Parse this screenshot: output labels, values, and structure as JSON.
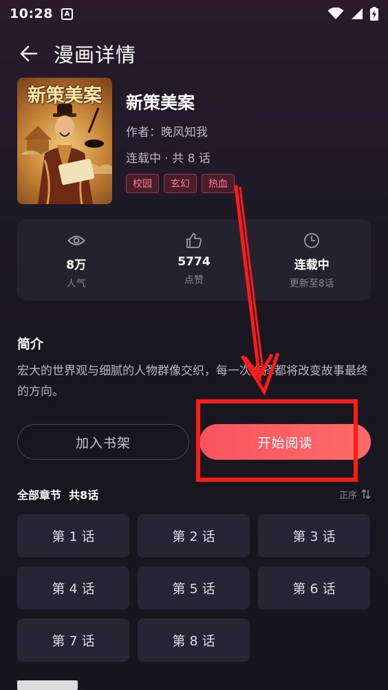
{
  "status_bar": {
    "time": "10:28",
    "a_icon": "A"
  },
  "header": {
    "title": "漫画详情"
  },
  "comic": {
    "cover_title": "新策美案",
    "title": "新策美案",
    "author": "作者：晚风知我",
    "status": "连载中 · 共 8 话",
    "tags": [
      "校园",
      "玄幻",
      "热血"
    ]
  },
  "stats": [
    {
      "icon": "eye-icon",
      "value": "8万",
      "label": "人气"
    },
    {
      "icon": "thumbs-up-icon",
      "value": "5774",
      "label": "点赞"
    },
    {
      "icon": "clock-icon",
      "value": "连载中",
      "label": "更新至8话"
    }
  ],
  "intro": {
    "title": "简介",
    "text": "宏大的世界观与细腻的人物群像交织，每一次选择都将改变故事最终的方向。"
  },
  "actions": {
    "shelf_label": "加入书架",
    "read_label": "开始阅读"
  },
  "chapters": {
    "title": "全部章节  共8话",
    "sort_label": "正序",
    "items": [
      "第 1 话",
      "第 2 话",
      "第 3 话",
      "第 4 话",
      "第 5 话",
      "第 6 话",
      "第 7 话",
      "第 8 话"
    ]
  },
  "colors": {
    "accent": "#f8555f",
    "annotation": "#ff1a1a",
    "background": "#17151d",
    "card": "#24222f"
  }
}
